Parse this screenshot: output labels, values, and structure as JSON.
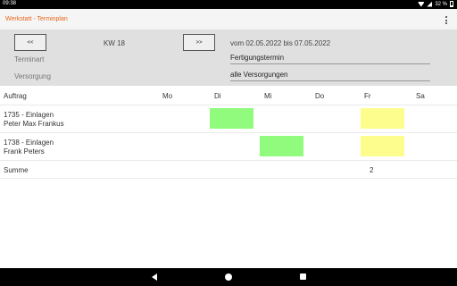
{
  "status_bar": {
    "time": "09:38",
    "battery": "32 %"
  },
  "app": {
    "title": "Werkstatt - Terminplan"
  },
  "navigation": {
    "prev_label": "<<",
    "next_label": ">>",
    "week_label": "KW 18",
    "date_range": "vom 02.05.2022 bis 07.05.2022"
  },
  "filters": {
    "terminart": {
      "label": "Terminart",
      "value": "Fertigungstermin"
    },
    "versorgung": {
      "label": "Versorgung",
      "value": "alle Versorgungen"
    }
  },
  "table": {
    "headers": [
      "Auftrag",
      "Mo",
      "Di",
      "Mi",
      "Do",
      "Fr",
      "Sa"
    ],
    "rows": [
      {
        "line1": "1735 - Einlagen",
        "line2": " Peter Max Frankus",
        "slots": [
          "Di",
          "Fr"
        ]
      },
      {
        "line1": "1738 - Einlagen",
        "line2": " Frank Peters",
        "slots": [
          "Mi",
          "Fr"
        ]
      }
    ],
    "summary": {
      "label": "Summe",
      "values": {
        "Fr": "2"
      }
    }
  },
  "colors": {
    "accent": "#e8651c",
    "slot_green": "#90fb7d",
    "slot_yellow": "#fdfd8d"
  },
  "icons": [
    "overflow-menu-icon",
    "wifi-icon",
    "signal-icon",
    "battery-icon",
    "nav-back-icon",
    "nav-home-icon",
    "nav-recents-icon"
  ]
}
